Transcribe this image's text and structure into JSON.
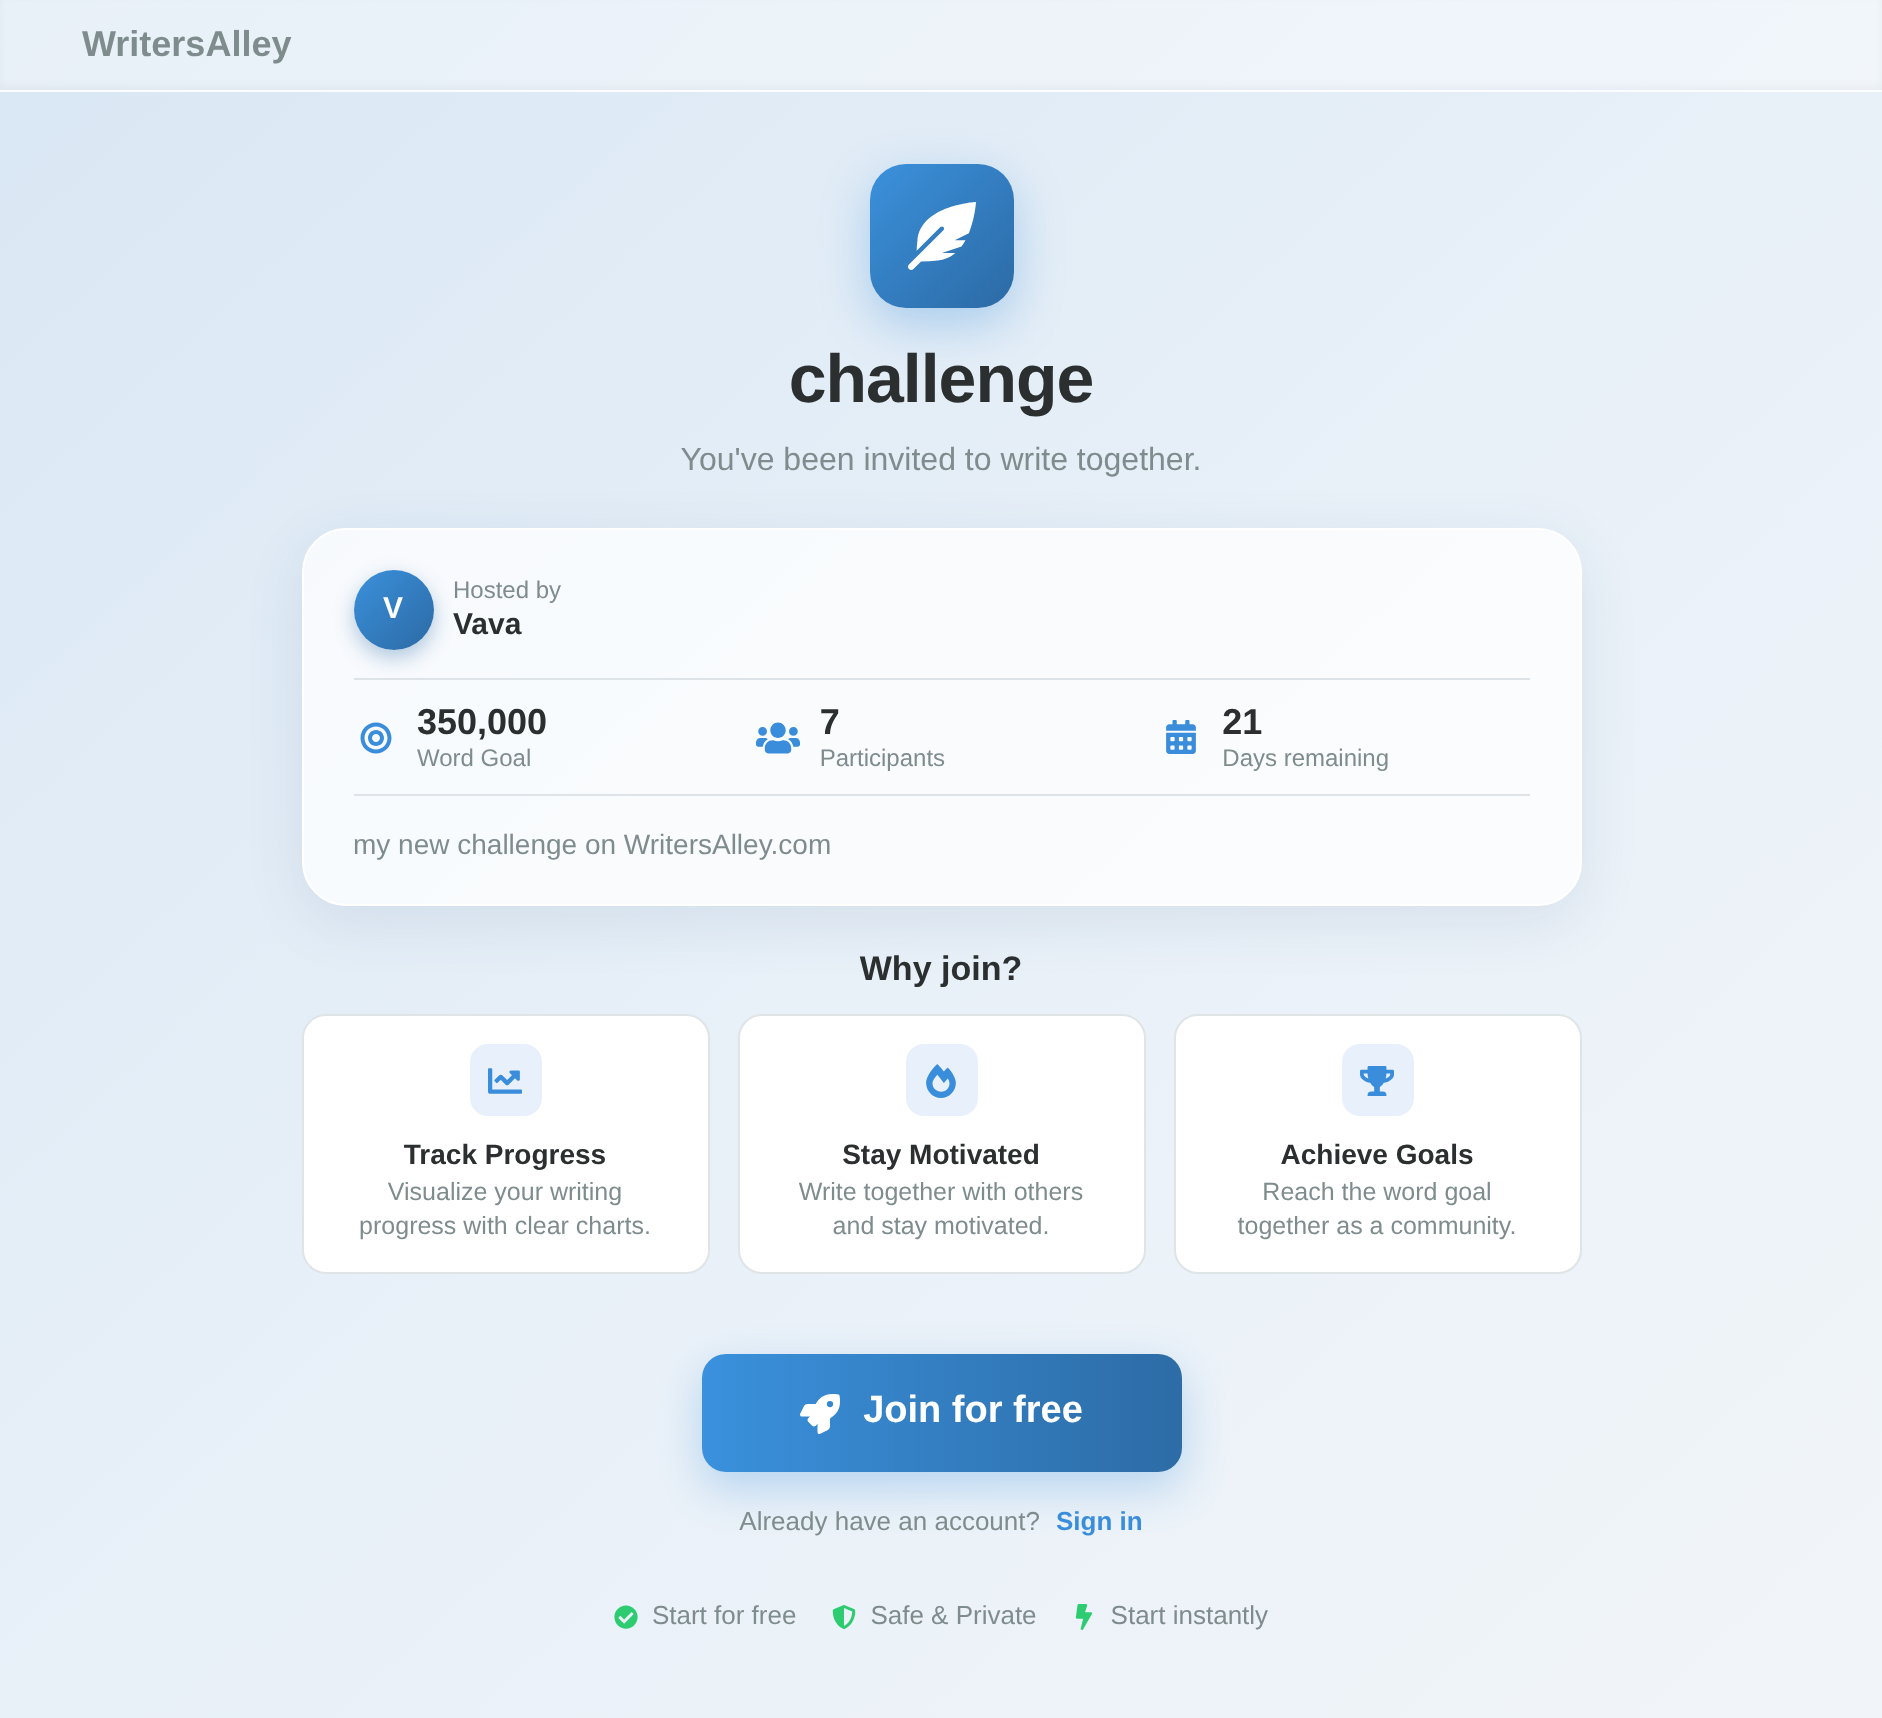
{
  "header": {
    "brand": "WritersAlley"
  },
  "hero": {
    "title": "challenge",
    "subtitle": "You've been invited to write together."
  },
  "host_card": {
    "avatar_initial": "V",
    "hosted_by_label": "Hosted by",
    "host_name": "Vava",
    "stats": [
      {
        "value": "350,000",
        "label": "Word Goal"
      },
      {
        "value": "7",
        "label": "Participants"
      },
      {
        "value": "21",
        "label": "Days remaining"
      }
    ],
    "description": "my new challenge on WritersAlley.com"
  },
  "why_join": {
    "title": "Why join?",
    "features": [
      {
        "title": "Track Progress",
        "description": "Visualize your writing progress with clear charts."
      },
      {
        "title": "Stay Motivated",
        "description": "Write together with others and stay motivated."
      },
      {
        "title": "Achieve Goals",
        "description": "Reach the word goal together as a community."
      }
    ]
  },
  "join_button": {
    "label": "Join for free"
  },
  "sign_in": {
    "prompt": "Already have an account?",
    "link": "Sign in"
  },
  "badges": [
    {
      "label": "Start for free"
    },
    {
      "label": "Safe & Private"
    },
    {
      "label": "Start instantly"
    }
  ]
}
